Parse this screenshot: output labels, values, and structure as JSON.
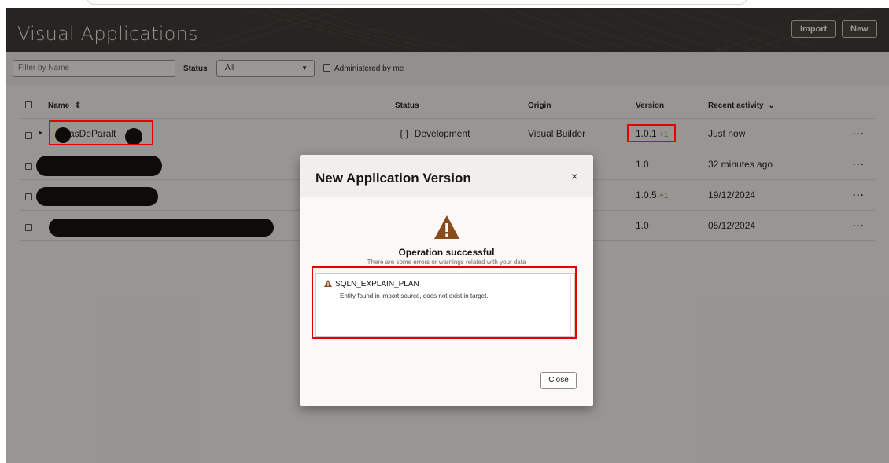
{
  "header": {
    "title": "Visual Applications",
    "import_label": "Import",
    "new_label": "New"
  },
  "filters": {
    "name_placeholder": "Filter by Name",
    "status_label": "Status",
    "status_value": "All",
    "administered_label": "Administered by me"
  },
  "table": {
    "columns": {
      "name": "Name",
      "status": "Status",
      "origin": "Origin",
      "version": "Version",
      "recent": "Recent activity"
    },
    "rows": [
      {
        "name": "asDeParalt",
        "status": "Development",
        "origin": "Visual Builder",
        "version": "1.0.1",
        "version_extra": "+1",
        "recent": "Just now",
        "menu": "···"
      },
      {
        "name": "",
        "status": "",
        "origin": "",
        "version": "1.0",
        "version_extra": "",
        "recent": "32 minutes ago",
        "menu": "···"
      },
      {
        "name": "",
        "status": "",
        "origin": "",
        "version": "1.0.5",
        "version_extra": "+1",
        "recent": "19/12/2024",
        "menu": "···"
      },
      {
        "name": "",
        "status": "",
        "origin": "",
        "version": "1.0",
        "version_extra": "",
        "recent": "05/12/2024",
        "menu": "···"
      }
    ]
  },
  "dialog": {
    "title": "New Application Version",
    "close_glyph": "×",
    "result_title": "Operation successful",
    "result_subtitle": "There are some errors or warnings related with your data",
    "message_code": "SQLN_EXPLAIN_PLAN",
    "message_text": "Entity found in import source, does not exist in target.",
    "close_button": "Close"
  },
  "icons": {
    "status_dev": "{ }",
    "sort": "⇕",
    "chevron": "⌄",
    "expand": "▸"
  },
  "colors": {
    "banner": "#312d2a",
    "warning": "#8a4b1c",
    "highlight": "#e30000",
    "version_plus": "#6d9b5d"
  }
}
